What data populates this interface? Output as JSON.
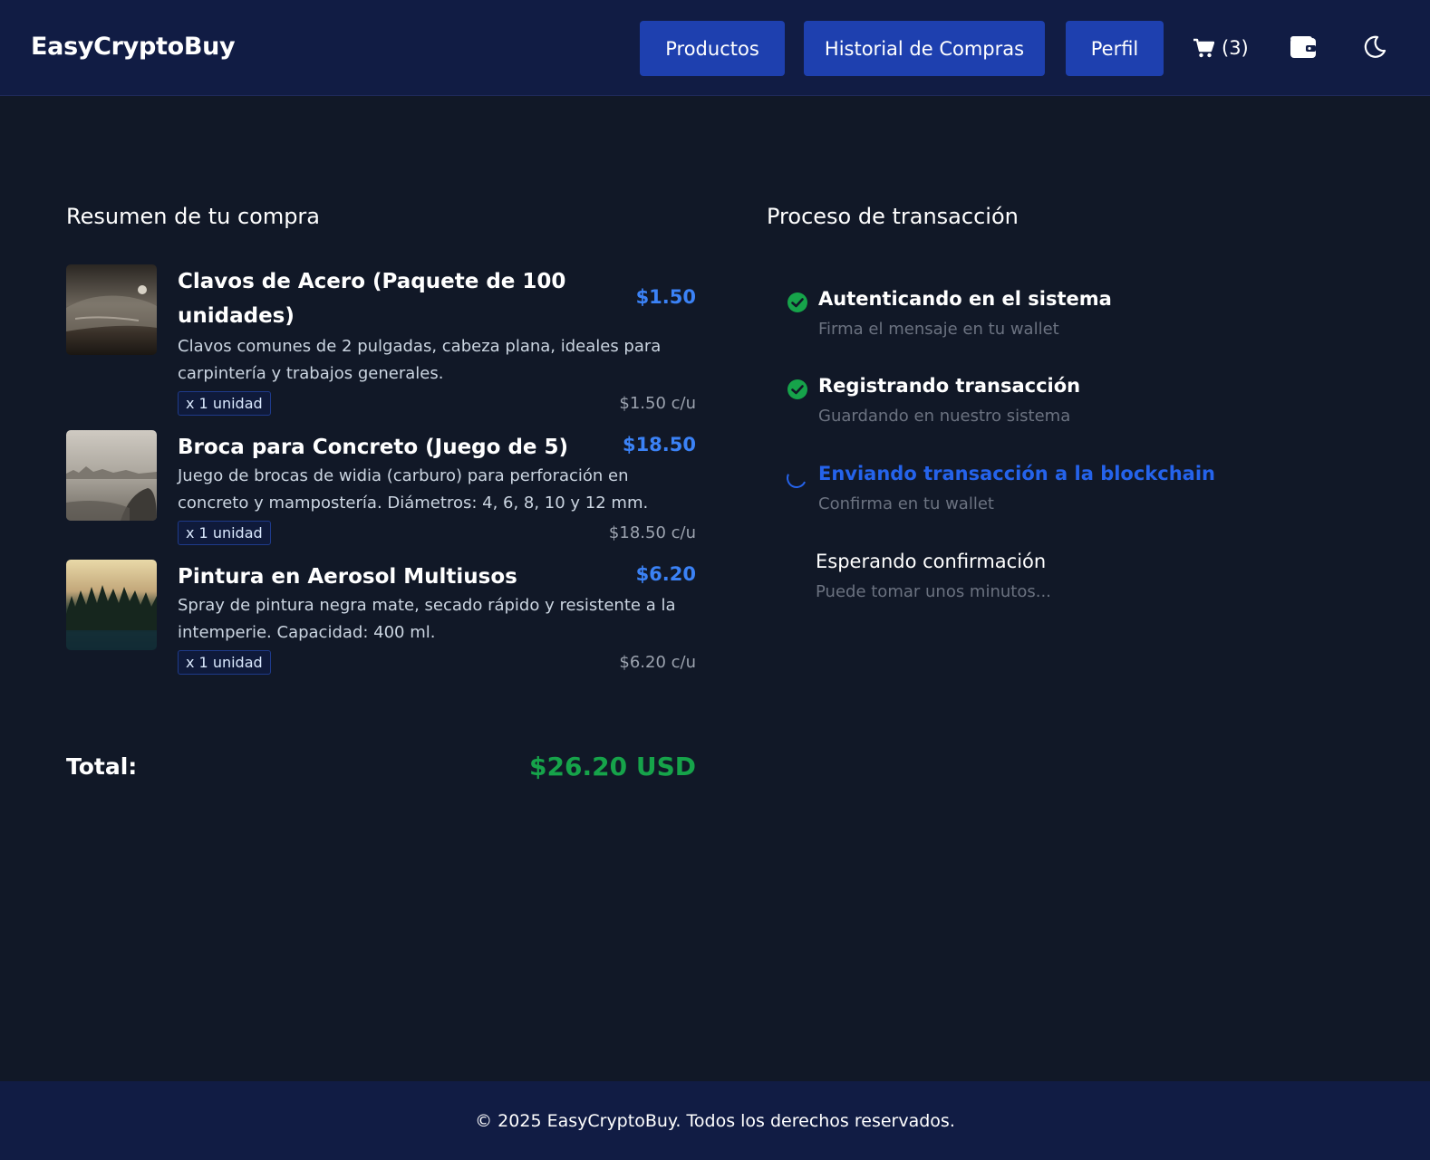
{
  "header": {
    "brand": "EasyCryptoBuy",
    "nav": {
      "products": "Productos",
      "history": "Historial de Compras",
      "profile": "Perfil"
    },
    "cart_count": "(3)"
  },
  "summary": {
    "title": "Resumen de tu compra",
    "items": [
      {
        "name": "Clavos de Acero (Paquete de 100 unidades)",
        "price": "$1.50",
        "description": "Clavos comunes de 2 pulgadas, cabeza plana, ideales para carpintería y trabajos generales.",
        "quantity": "x 1 unidad",
        "unit_price": "$1.50 c/u"
      },
      {
        "name": "Broca para Concreto (Juego de 5)",
        "price": "$18.50",
        "description": "Juego de brocas de widia (carburo) para perforación en concreto y mampostería. Diámetros: 4, 6, 8, 10 y 12 mm.",
        "quantity": "x 1 unidad",
        "unit_price": "$18.50 c/u"
      },
      {
        "name": "Pintura en Aerosol Multiusos",
        "price": "$6.20",
        "description": "Spray de pintura negra mate, secado rápido y resistente a la intemperie. Capacidad: 400 ml.",
        "quantity": "x 1 unidad",
        "unit_price": "$6.20 c/u"
      }
    ],
    "total_label": "Total:",
    "total_value": "$26.20 USD"
  },
  "process": {
    "title": "Proceso de transacción",
    "steps": [
      {
        "title": "Autenticando en el sistema",
        "subtitle": "Firma el mensaje en tu wallet",
        "status": "done"
      },
      {
        "title": "Registrando transacción",
        "subtitle": "Guardando en nuestro sistema",
        "status": "done"
      },
      {
        "title": "Enviando transacción a la blockchain",
        "subtitle": "Confirma en tu wallet",
        "status": "active"
      },
      {
        "title": "Esperando confirmación",
        "subtitle": "Puede tomar unos minutos...",
        "status": "pending"
      }
    ]
  },
  "footer": {
    "text": "© 2025 EasyCryptoBuy. Todos los derechos reservados."
  },
  "colors": {
    "background": "#111827",
    "header": "#111c44",
    "nav_button": "#1e40af",
    "price": "#3b82f6",
    "total": "#16a34a",
    "success": "#16a34a",
    "active": "#2563eb"
  },
  "icons": {
    "cart": "cart-icon",
    "wallet": "wallet-icon",
    "theme": "moon-icon",
    "done": "check-circle-icon",
    "active": "spinner-icon"
  }
}
